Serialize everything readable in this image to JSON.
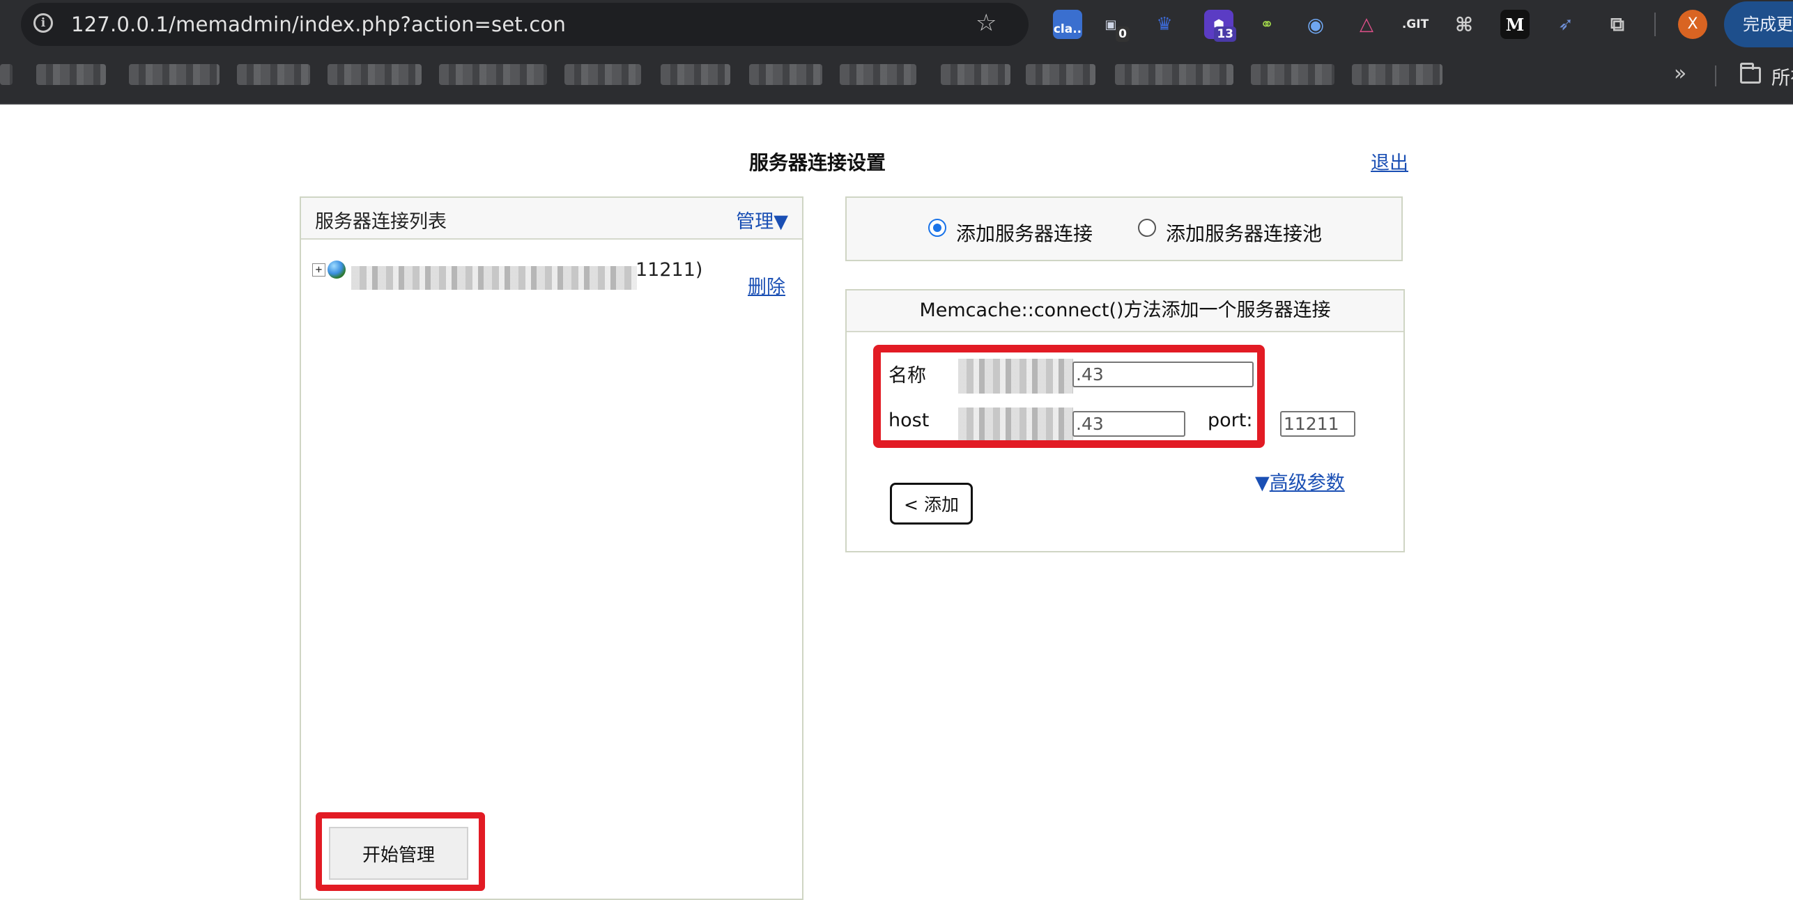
{
  "browser": {
    "url": "127.0.0.1/memadmin/index.php?action=set.con",
    "extensions": [
      {
        "icon": "cloud-extension-icon",
        "label": "cla..",
        "badge": ""
      },
      {
        "icon": "counter-extension-icon",
        "label": "",
        "badge": "0"
      },
      {
        "icon": "translate-extension-icon",
        "label": "",
        "badge": ""
      },
      {
        "icon": "shield-extension-icon",
        "label": "",
        "badge": "13"
      },
      {
        "icon": "link-extension-icon",
        "label": "",
        "badge": ""
      },
      {
        "icon": "mask-extension-icon",
        "label": "",
        "badge": ""
      },
      {
        "icon": "graph-extension-icon",
        "label": "",
        "badge": ""
      },
      {
        "icon": "git-extension-icon",
        "label": ".GIT",
        "badge": ""
      },
      {
        "icon": "settings-extension-icon",
        "label": "",
        "badge": ""
      },
      {
        "icon": "medium-extension-icon",
        "label": "M",
        "badge": ""
      },
      {
        "icon": "rocket-extension-icon",
        "label": "",
        "badge": ""
      },
      {
        "icon": "puzzle-extensions-icon",
        "label": "",
        "badge": ""
      }
    ],
    "avatar_letter": "X",
    "finish_button": "完成更",
    "bookmarks_all": "所有"
  },
  "page": {
    "title": "服务器连接设置",
    "logout": "退出"
  },
  "server_list": {
    "title": "服务器连接列表",
    "manage": "管理",
    "manage_arrow": "▼",
    "server_port": "11211)",
    "delete": "删除",
    "start_button": "开始管理"
  },
  "mode": {
    "option_single": "添加服务器连接",
    "option_pool": "添加服务器连接池",
    "selected": "single"
  },
  "form": {
    "header": "Memcache::connect()方法添加一个服务器连接",
    "name_label": "名称",
    "name_value": ".43",
    "host_label": "host",
    "host_value": ".43",
    "port_label": "port:",
    "port_value": "11211",
    "advanced_arrow": "▼",
    "advanced": "高级参数",
    "add_button": "< 添加"
  },
  "colors": {
    "link": "#1a4fb4",
    "highlight": "#e21b24",
    "chrome_dark": "#2c2d30",
    "radio_selected": "#1a73e8"
  }
}
